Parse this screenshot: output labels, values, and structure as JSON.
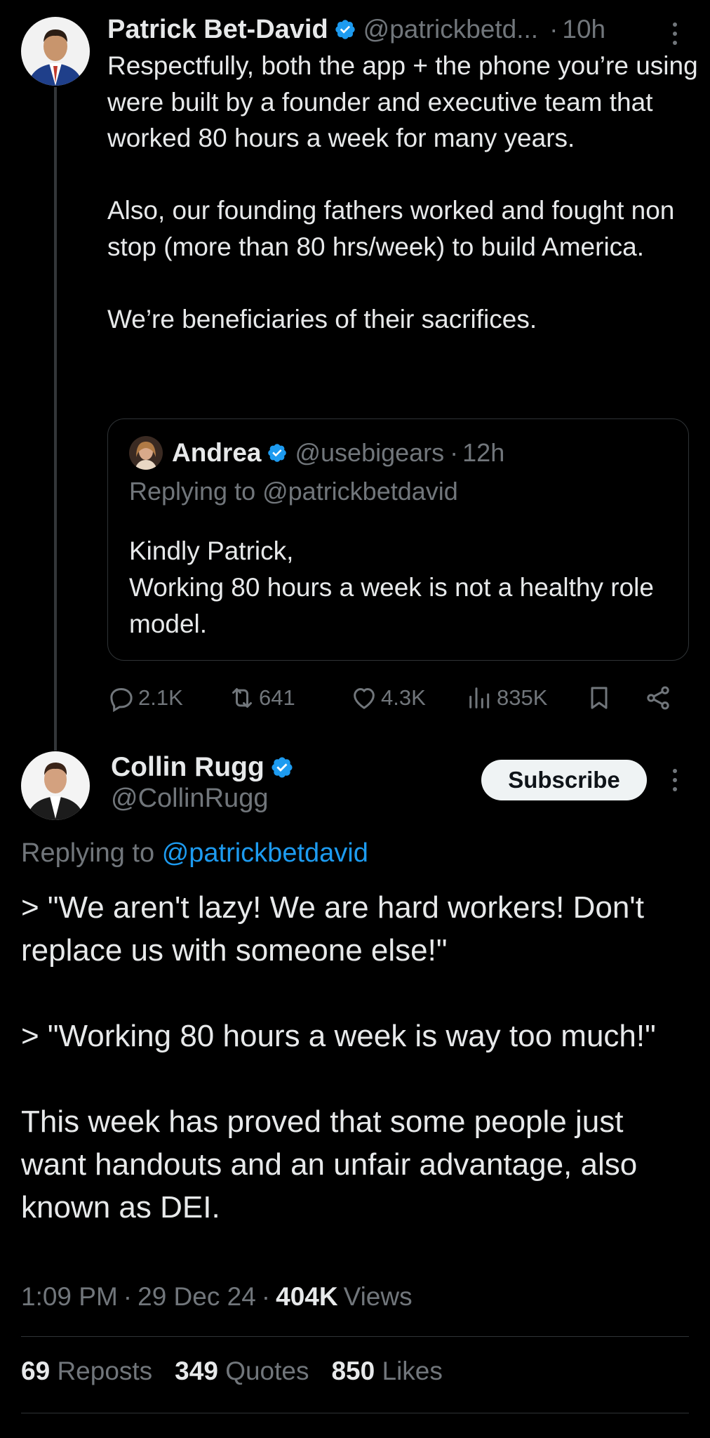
{
  "parent_tweet": {
    "author_name": "Patrick Bet-David",
    "handle": "@patrickbetd...",
    "time": "10h",
    "text_paragraphs": [
      "Respectfully, both the app + the phone you’re using were built by a founder and executive team that worked 80 hours a week for many years.",
      "",
      "Also, our founding fathers worked and fought non stop (more than 80 hrs/week) to build America.",
      "",
      "We’re beneficiaries of their sacrifices."
    ],
    "quoted": {
      "author_name": "Andrea",
      "handle": "@usebigears",
      "time": "12h",
      "replying_to": "Replying to @patrickbetdavid",
      "text_lines": [
        "Kindly Patrick,",
        "Working 80 hours a week is not a healthy role model."
      ]
    },
    "actions": {
      "replies": "2.1K",
      "reposts": "641",
      "likes": "4.3K",
      "views": "835K"
    }
  },
  "main_tweet": {
    "author_name": "Collin Rugg",
    "handle": "@CollinRugg",
    "subscribe_label": "Subscribe",
    "replying_prefix": "Replying to",
    "replying_handle": "@patrickbetdavid",
    "text_paragraphs": [
      "> \"We aren't lazy! We are hard workers! Don't replace us with someone else!\"",
      "",
      "> \"Working 80 hours a week is way too much!\"",
      "",
      "This week has proved that some people just want handouts and an unfair advantage, also known as DEI."
    ],
    "time": "1:09 PM",
    "date": "29 Dec 24",
    "views_count": "404K",
    "views_label": "Views",
    "stats": {
      "reposts_count": "69",
      "reposts_label": "Reposts",
      "quotes_count": "349",
      "quotes_label": "Quotes",
      "likes_count": "850",
      "likes_label": "Likes"
    }
  },
  "colors": {
    "background": "#000000",
    "text_primary": "#e7e9ea",
    "text_secondary": "#71767b",
    "link": "#1d9bf0",
    "verified": "#1d9bf0",
    "border": "#2f3336"
  },
  "icons": [
    "verified-badge-icon",
    "more-icon",
    "reply-icon",
    "repost-icon",
    "like-icon",
    "views-icon",
    "bookmark-icon",
    "share-icon"
  ]
}
